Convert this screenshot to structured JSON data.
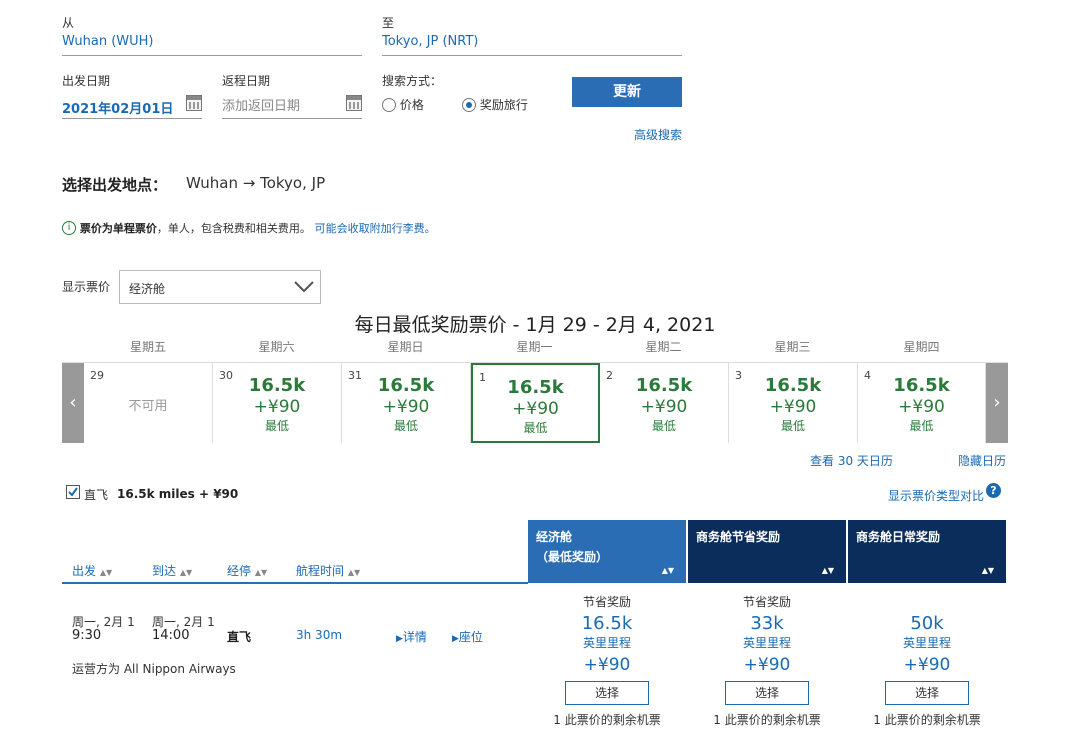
{
  "search": {
    "from_label": "从",
    "from_value": "Wuhan (WUH)",
    "to_label": "至",
    "to_value": "Tokyo, JP (NRT)",
    "depart_label": "出发日期",
    "depart_value": "2021年02月01日",
    "return_label": "返程日期",
    "return_placeholder": "添加返回日期",
    "method_label": "搜索方式：",
    "option_price": "价格",
    "option_award": "奖励旅行",
    "update_button": "更新",
    "advanced_link": "高级搜索"
  },
  "route": {
    "label": "选择出发地点：",
    "value": "Wuhan → Tokyo, JP"
  },
  "notice": {
    "bold": "票价为单程票价",
    "text": "，单人，包含税费和相关费用。",
    "link": "可能会收取附加行李费。"
  },
  "fare_display": {
    "label": "显示票价",
    "selected": "经济舱"
  },
  "calendar": {
    "title": "每日最低奖励票价 - 1月 29 - 2月 4, 2021",
    "weekdays": [
      "星期五",
      "星期六",
      "星期日",
      "星期一",
      "星期二",
      "星期三",
      "星期四"
    ],
    "days": [
      {
        "num": "29",
        "status": "不可用"
      },
      {
        "num": "30",
        "miles": "16.5k",
        "tax": "+¥90",
        "low": "最低"
      },
      {
        "num": "31",
        "miles": "16.5k",
        "tax": "+¥90",
        "low": "最低"
      },
      {
        "num": "1",
        "miles": "16.5k",
        "tax": "+¥90",
        "low": "最低"
      },
      {
        "num": "2",
        "miles": "16.5k",
        "tax": "+¥90",
        "low": "最低"
      },
      {
        "num": "3",
        "miles": "16.5k",
        "tax": "+¥90",
        "low": "最低"
      },
      {
        "num": "4",
        "miles": "16.5k",
        "tax": "+¥90",
        "low": "最低"
      }
    ],
    "selected_index": 3,
    "view30_link": "查看 30 天日历",
    "hide_link": "隐藏日历"
  },
  "filters": {
    "nonstop_label": "直飞",
    "nonstop_price": "16.5k miles + ¥90",
    "compare_link": "显示票价类型对比"
  },
  "columns": {
    "depart": "出发",
    "arrive": "到达",
    "stops": "经停",
    "duration": "航程时间"
  },
  "fare_headers": [
    {
      "line1": "经济舱",
      "line2": "（最低奖励）",
      "color": "#2a6db5"
    },
    {
      "line1": "商务舱节省奖励",
      "line2": "",
      "color": "#0b2d5c"
    },
    {
      "line1": "商务舱日常奖励",
      "line2": "",
      "color": "#0b2d5c"
    }
  ],
  "flight": {
    "depart_date": "周一, 2月 1",
    "depart_time": "9:30",
    "arrive_date": "周一, 2月 1",
    "arrive_time": "14:00",
    "stops": "直飞",
    "duration": "3h 30m",
    "details_link": "详情",
    "seats_link": "座位",
    "operator": "运营方为 All Nippon Airways",
    "fares": [
      {
        "type": "节省奖励",
        "miles": "16.5k",
        "unit": "英里里程",
        "price": "+¥90",
        "select": "选择",
        "seats": "1 此票价的剩余机票"
      },
      {
        "type": "节省奖励",
        "miles": "33k",
        "unit": "英里里程",
        "price": "+¥90",
        "select": "选择",
        "seats": "1 此票价的剩余机票"
      },
      {
        "type": "",
        "miles": "50k",
        "unit": "英里里程",
        "price": "+¥90",
        "select": "选择",
        "seats": "1 此票价的剩余机票"
      }
    ]
  },
  "colors": {
    "link": "#1a6ab3",
    "award_green": "#2b7a3b",
    "header_blue": "#2a6db5",
    "header_navy": "#0b2d5c"
  }
}
